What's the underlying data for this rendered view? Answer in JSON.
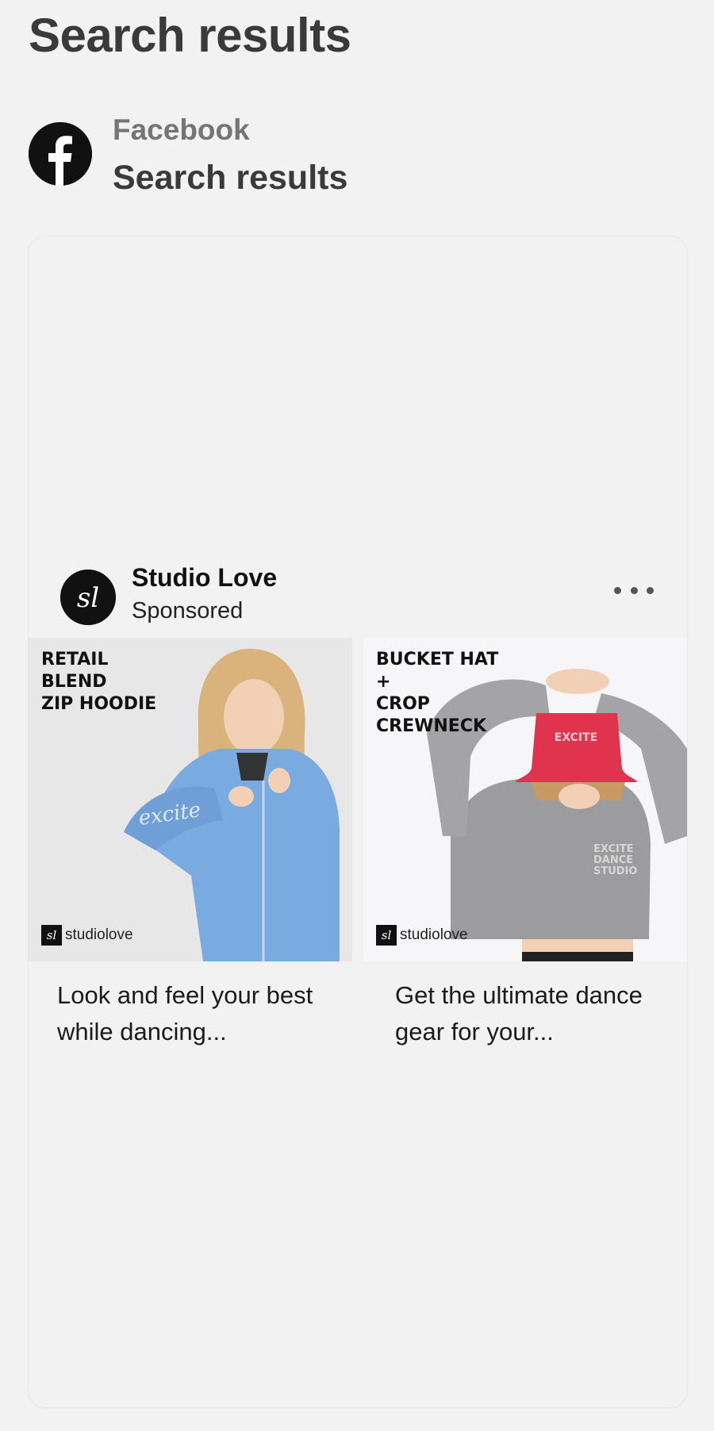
{
  "header": {
    "title": "Search results"
  },
  "source": {
    "logo_icon": "facebook-icon",
    "name": "Facebook",
    "subtitle": "Search results"
  },
  "ad": {
    "advertiser": "Studio Love",
    "label": "Sponsored",
    "more_icon": "more-horizontal-icon",
    "items": [
      {
        "overlay": "RETAIL\nBLEND\nZIP HOODIE",
        "brand": "studiolove",
        "description": "Look and feel your best while dancing..."
      },
      {
        "overlay": "BUCKET HAT\n+\nCROP\nCREWNECK",
        "brand": "studiolove",
        "description": "Get the ultimate dance gear for your..."
      }
    ]
  },
  "colors": {
    "background": "#f2f2f2",
    "title": "#3a3a3a",
    "muted": "#757575",
    "hoodie_blue": "#7aaee3",
    "hat_red": "#e0344e",
    "sweater_grey": "#9c9c9e"
  }
}
